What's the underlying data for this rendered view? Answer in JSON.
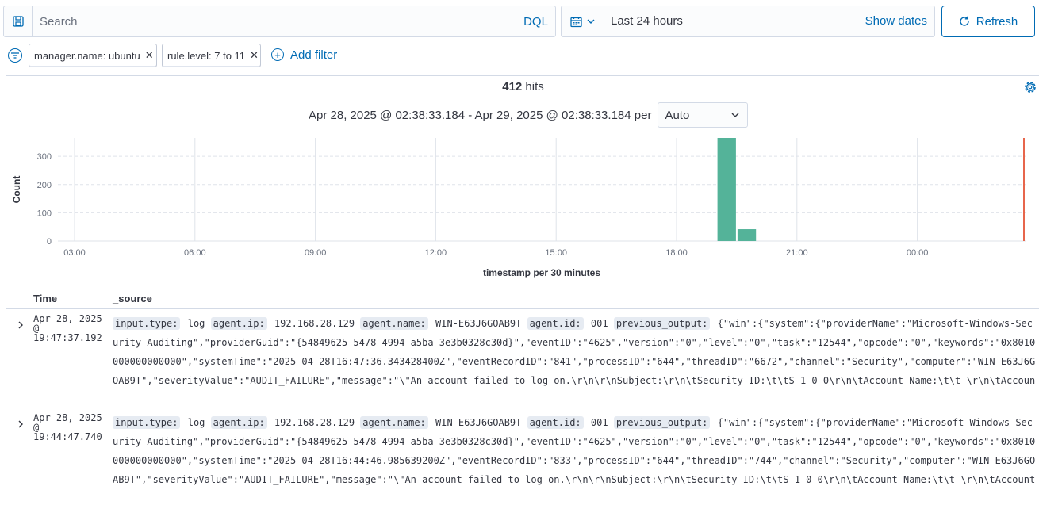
{
  "query_bar": {
    "save_icon": "save-icon",
    "search_placeholder": "Search",
    "language_label": "DQL"
  },
  "date_picker": {
    "calendar_icon": "calendar-icon",
    "range_label": "Last 24 hours",
    "show_dates_label": "Show dates"
  },
  "refresh": {
    "label": "Refresh",
    "icon": "refresh-icon"
  },
  "filters": {
    "items": [
      {
        "label": "manager.name: ubuntu"
      },
      {
        "label": "rule.level: 7 to 11"
      }
    ],
    "add_label": "Add filter"
  },
  "summary": {
    "hits_count": "412",
    "hits_label": "hits",
    "range_text": "Apr 28, 2025 @ 02:38:33.184 - Apr 29, 2025 @ 02:38:33.184 per",
    "interval_value": "Auto"
  },
  "chart_data": {
    "type": "bar",
    "xlabel": "timestamp per 30 minutes",
    "ylabel": "Count",
    "x_ticks": [
      "03:00",
      "06:00",
      "09:00",
      "12:00",
      "15:00",
      "18:00",
      "21:00",
      "00:00"
    ],
    "y_ticks": [
      0,
      100,
      200,
      300
    ],
    "ylim": [
      0,
      365
    ],
    "grid": true,
    "bars": [
      {
        "x": "19:00",
        "value": 370
      },
      {
        "x": "19:30",
        "value": 42
      }
    ],
    "bar_color": "#54b399",
    "now_marker_color": "#e7664c"
  },
  "table": {
    "col_time": "Time",
    "col_source": "_source",
    "rows": [
      {
        "time": "Apr 28, 2025 @ 19:47:37.192",
        "fields": [
          {
            "k": "input.type:",
            "v": "log"
          },
          {
            "k": "agent.ip:",
            "v": "192.168.28.129"
          },
          {
            "k": "agent.name:",
            "v": "WIN-E63J6GOAB9T"
          },
          {
            "k": "agent.id:",
            "v": "001"
          },
          {
            "k": "previous_output:",
            "v": "{\"win\":{\"system\":{\"providerName\":\"Microsoft-Windows-Security-Auditing\",\"providerGuid\":\"{54849625-5478-4994-a5ba-3e3b0328c30d}\",\"eventID\":\"4625\",\"version\":\"0\",\"level\":\"0\",\"task\":\"12544\",\"opcode\":\"0\",\"keywords\":\"0x8010000000000000\",\"systemTime\":\"2025-04-28T16:47:36.343428400Z\",\"eventRecordID\":\"841\",\"processID\":\"644\",\"threadID\":\"6672\",\"channel\":\"Security\",\"computer\":\"WIN-E63J6GOAB9T\",\"severityValue\":\"AUDIT_FAILURE\",\"message\":\"\\\"An account failed to log on.\\r\\n\\r\\nSubject:\\r\\n\\tSecurity ID:\\t\\tS-1-0-0\\r\\n\\tAccount Name:\\t\\t-\\r\\n\\tAccount Domain:\\t\\t-\\r\\n\\tLogon ID:\\t\\t0x0\\r\\n\\r\\nLogon Type:\\t\\t\\t3\\r\\n\\r\\nAccount For Which Logon Failed:\\r\\n\\tSecurity ID:\\t\\tS-1-0-0\\r\\n\\tAccount Name:\\t\\trandomuser"
          }
        ]
      },
      {
        "time": "Apr 28, 2025 @ 19:44:47.740",
        "fields": [
          {
            "k": "input.type:",
            "v": "log"
          },
          {
            "k": "agent.ip:",
            "v": "192.168.28.129"
          },
          {
            "k": "agent.name:",
            "v": "WIN-E63J6GOAB9T"
          },
          {
            "k": "agent.id:",
            "v": "001"
          },
          {
            "k": "previous_output:",
            "v": "{\"win\":{\"system\":{\"providerName\":\"Microsoft-Windows-Security-Auditing\",\"providerGuid\":\"{54849625-5478-4994-a5ba-3e3b0328c30d}\",\"eventID\":\"4625\",\"version\":\"0\",\"level\":\"0\",\"task\":\"12544\",\"opcode\":\"0\",\"keywords\":\"0x8010000000000000\",\"systemTime\":\"2025-04-28T16:44:46.985639200Z\",\"eventRecordID\":\"833\",\"processID\":\"644\",\"threadID\":\"744\",\"channel\":\"Security\",\"computer\":\"WIN-E63J6GOAB9T\",\"severityValue\":\"AUDIT_FAILURE\",\"message\":\"\\\"An account failed to log on.\\r\\n\\r\\nSubject:\\r\\n\\tSecurity ID:\\t\\tS-1-0-0\\r\\n\\tAccount Name:\\t\\t-\\r\\n\\tAccount Domain:\\t\\t-\\r\\n\\tLogon ID:\\t\\t0x0\\r\\n\\r\\nLogon Type:\\t\\t\\t3\\r\\n\\r\\nAccount For Which Logon Failed:\\r\\n\\tSecurity ID:\\t\\tS-1-0-0\\r\\n\\tAccount Name:\\t\\trandomuser"
          }
        ]
      }
    ]
  }
}
